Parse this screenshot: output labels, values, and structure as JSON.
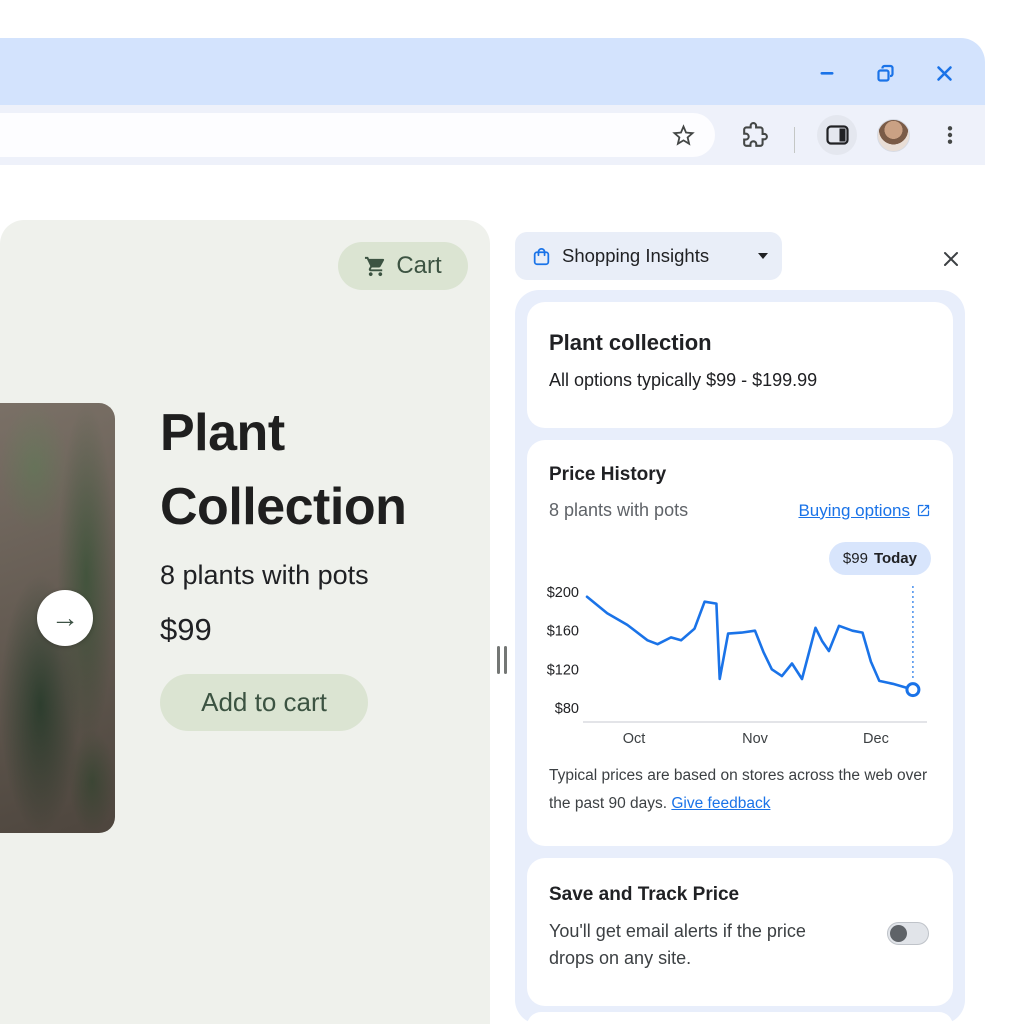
{
  "colors": {
    "accent": "#1a73e8",
    "titlebar": "#d3e3fd",
    "toolbar": "#eef1fa",
    "page_bg": "#eff1ec",
    "pill_green_bg": "#dbe4d2",
    "pill_green_text": "#3c5342",
    "panel_bg": "#e8eefb",
    "badge_bg": "#d8e5fc",
    "link": "#1a73e8",
    "text_primary": "#202124",
    "text_secondary": "#5f6368"
  },
  "icons": {
    "window": [
      "minimize-icon",
      "restore-icon",
      "close-icon"
    ],
    "toolbar": [
      "star-icon",
      "puzzle-icon",
      "side-panel-icon",
      "profile-avatar",
      "kebab-menu-icon"
    ],
    "page": [
      "cart-icon",
      "arrow-right-icon"
    ],
    "panel": [
      "shopping-bag-icon",
      "chevron-down-icon",
      "close-icon",
      "external-link-icon",
      "toggle-off"
    ]
  },
  "page": {
    "cart_button": "Cart",
    "title_line1": "Plant",
    "title_line2": "Collection",
    "subtitle": "8 plants with pots",
    "price": "$99",
    "add_to_cart": "Add to cart"
  },
  "panel": {
    "header": "Shopping Insights",
    "summary_card": {
      "title": "Plant collection",
      "subtitle": "All options typically $99 - $199.99"
    },
    "price_history": {
      "title": "Price History",
      "subtitle": "8 plants with pots",
      "buying_options": "Buying options",
      "badge_price": "$99",
      "badge_label": "Today",
      "caption_line1": "Typical prices are based on stores across the web over",
      "caption_line2": "the past 90 days.",
      "feedback_link": "Give feedback"
    },
    "track_card": {
      "title": "Save and Track Price",
      "body_line1": "You'll get email alerts if the price",
      "body_line2": "drops on any site."
    }
  },
  "chart_data": {
    "type": "line",
    "title": "Price History",
    "series": [
      {
        "name": "Typical price",
        "points": [
          [
            0,
            195
          ],
          [
            0.06,
            178
          ],
          [
            0.12,
            166
          ],
          [
            0.18,
            150
          ],
          [
            0.21,
            146
          ],
          [
            0.25,
            153
          ],
          [
            0.28,
            150
          ],
          [
            0.32,
            162
          ],
          [
            0.35,
            190
          ],
          [
            0.385,
            188
          ],
          [
            0.395,
            110
          ],
          [
            0.42,
            157
          ],
          [
            0.46,
            158
          ],
          [
            0.5,
            160
          ],
          [
            0.525,
            138
          ],
          [
            0.55,
            120
          ],
          [
            0.58,
            113
          ],
          [
            0.61,
            126
          ],
          [
            0.64,
            110
          ],
          [
            0.68,
            163
          ],
          [
            0.7,
            149
          ],
          [
            0.72,
            139
          ],
          [
            0.75,
            165
          ],
          [
            0.79,
            160
          ],
          [
            0.82,
            158
          ],
          [
            0.845,
            128
          ],
          [
            0.87,
            108
          ],
          [
            0.91,
            105
          ],
          [
            0.97,
            99
          ]
        ]
      }
    ],
    "ylim": [
      80,
      200
    ],
    "yticks": [
      200,
      160,
      120,
      80
    ],
    "ytick_labels": [
      "$200",
      "$160",
      "$120",
      "$80"
    ],
    "xtick_labels": [
      "Oct",
      "Nov",
      "Dec"
    ],
    "xtick_fractions": [
      0.14,
      0.5,
      0.86
    ],
    "current_price": {
      "fraction": 0.97,
      "value": 99,
      "label": "$99 Today",
      "marker": "open-circle",
      "dotted_reference_line": true
    },
    "line_color": "#1a73e8",
    "axis_color": "#dadce0",
    "grid": false,
    "legend": false
  }
}
